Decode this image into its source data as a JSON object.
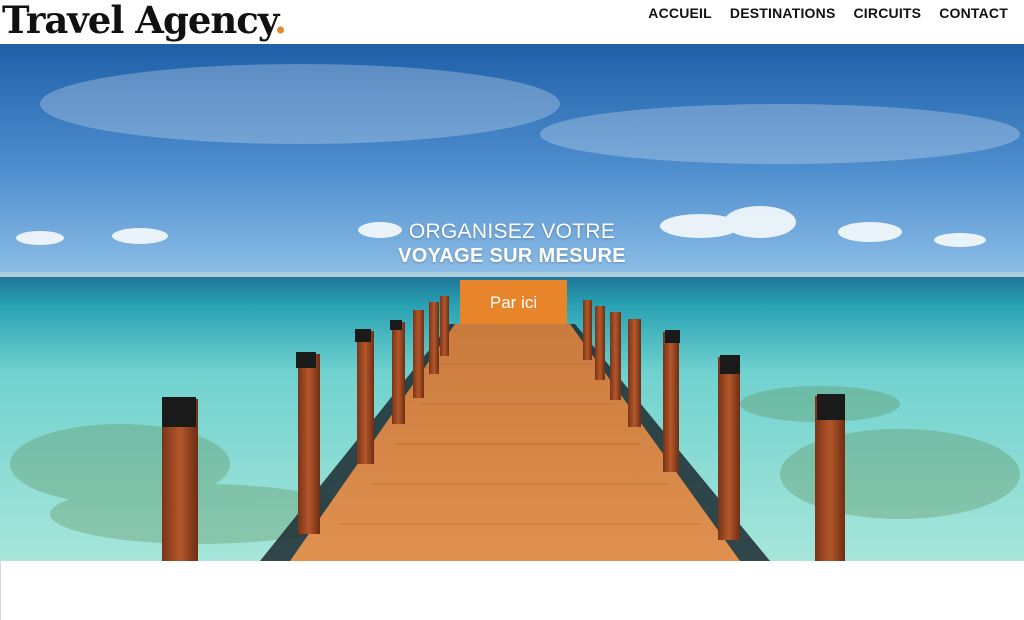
{
  "brand": {
    "name": "Travel Agency",
    "dot": ".",
    "accent_color": "#e8852b"
  },
  "nav": {
    "items": [
      {
        "label": "ACCUEIL"
      },
      {
        "label": "DESTINATIONS"
      },
      {
        "label": "CIRCUITS"
      },
      {
        "label": "CONTACT"
      }
    ]
  },
  "hero": {
    "title_line1": "ORGANISEZ VOTRE",
    "title_line2": "VOYAGE SUR MESURE",
    "cta_label": "Par ici",
    "image": "tropical-pier-photo"
  }
}
